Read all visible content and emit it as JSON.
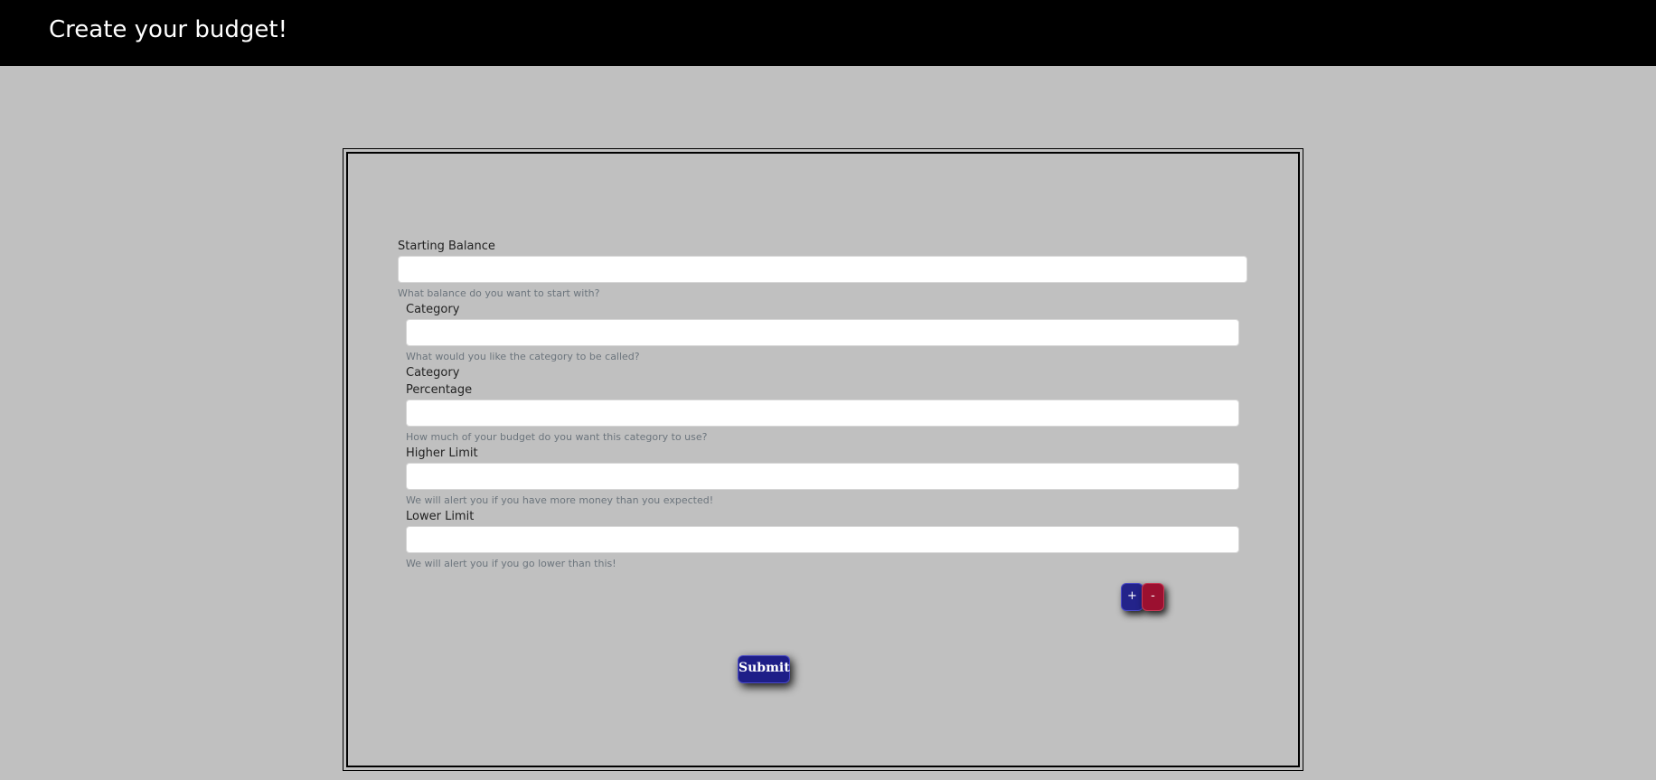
{
  "header": {
    "title": "Create your budget!"
  },
  "form": {
    "starting_balance": {
      "label": "Starting Balance",
      "value": "",
      "help": "What balance do you want to start with?"
    },
    "category": {
      "label": "Category",
      "value": "",
      "help": "What would you like the category to be called?"
    },
    "category_percentage": {
      "label_line1": "Category",
      "label_line2": "Percentage",
      "value": "",
      "help": "How much of your budget do you want this category to use?"
    },
    "higher_limit": {
      "label": "Higher Limit",
      "value": "",
      "help": "We will alert you if you have more money than you expected!"
    },
    "lower_limit": {
      "label": "Lower Limit",
      "value": "",
      "help": "We will alert you if you go lower than this!"
    },
    "add_label": "+",
    "remove_label": "-",
    "submit_label": "Submit"
  },
  "colors": {
    "header_bg": "#000000",
    "page_bg": "#c0c0c0",
    "add_button": "#23238a",
    "remove_button": "#9b1030",
    "submit_button": "#1e1e88"
  }
}
